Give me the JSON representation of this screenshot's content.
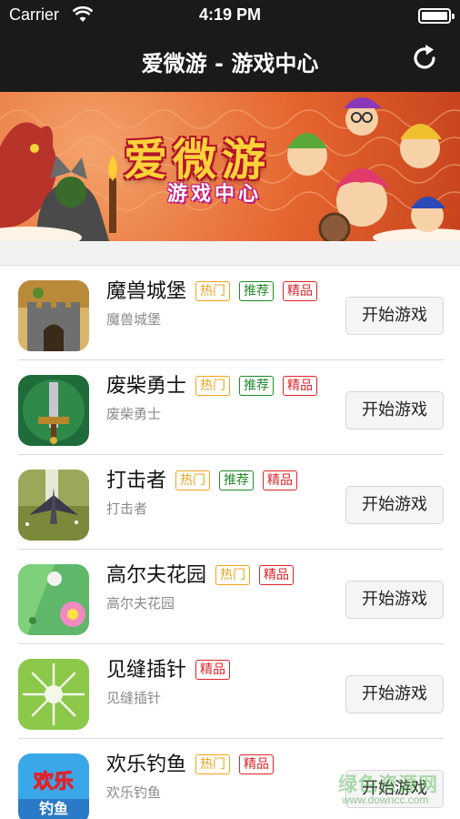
{
  "status_bar": {
    "carrier": "Carrier",
    "time": "4:19 PM"
  },
  "nav": {
    "title": "爱微游 - 游戏中心",
    "refresh_icon": "refresh-icon"
  },
  "banner": {
    "title": "爱微游",
    "subtitle": "游戏中心"
  },
  "tags": {
    "hot": "热门",
    "recommended": "推荐",
    "featured": "精品"
  },
  "games": [
    {
      "name": "魔兽城堡",
      "subtitle": "魔兽城堡",
      "hot": "热门",
      "rec": "推荐",
      "best": "精品",
      "button": "开始游戏"
    },
    {
      "name": "废柴勇士",
      "subtitle": "废柴勇士",
      "hot": "热门",
      "rec": "推荐",
      "best": "精品",
      "button": "开始游戏"
    },
    {
      "name": "打击者",
      "subtitle": "打击者",
      "hot": "热门",
      "rec": "推荐",
      "best": "精品",
      "button": "开始游戏"
    },
    {
      "name": "高尔夫花园",
      "subtitle": "高尔夫花园",
      "hot": "热门",
      "best": "精品",
      "button": "开始游戏"
    },
    {
      "name": "见缝插针",
      "subtitle": "见缝插针",
      "best": "精品",
      "button": "开始游戏"
    },
    {
      "name": "欢乐钓鱼",
      "subtitle": "欢乐钓鱼",
      "hot": "热门",
      "best": "精品",
      "button": "开始游戏"
    }
  ],
  "watermark": {
    "text": "绿色资源网",
    "url": "www.downcc.com"
  },
  "colors": {
    "nav_bg": "#1a1a1a",
    "hot": "#f0a31a",
    "recommended": "#1f8a2a",
    "featured": "#e0222b"
  }
}
